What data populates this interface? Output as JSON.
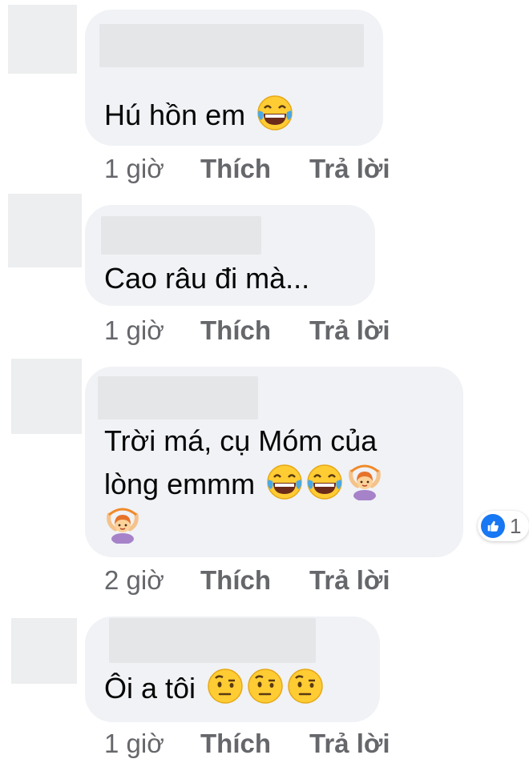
{
  "comments": [
    {
      "text": "Hú hồn em",
      "emojis": [
        "face-with-tears-of-joy-icon"
      ],
      "time": "1 giờ",
      "like_label": "Thích",
      "reply_label": "Trả lời"
    },
    {
      "text": "Cao râu đi mà...",
      "time": "1 giờ",
      "like_label": "Thích",
      "reply_label": "Trả lời"
    },
    {
      "text_line1": "Trời má, cụ Móm của",
      "text_line2": "lòng emmm",
      "emojis": [
        "face-with-tears-of-joy-icon",
        "face-with-tears-of-joy-icon",
        "person-gesturing-ok-icon",
        "person-gesturing-ok-icon"
      ],
      "reaction_count": "1",
      "reaction_icon": "like-icon",
      "time": "2 giờ",
      "like_label": "Thích",
      "reply_label": "Trả lời"
    },
    {
      "text": "Ôi a tôi",
      "emojis": [
        "face-with-raised-eyebrow-icon",
        "face-with-raised-eyebrow-icon",
        "face-with-raised-eyebrow-icon"
      ],
      "time": "1 giờ",
      "like_label": "Thích",
      "reply_label": "Trả lời"
    }
  ],
  "colors": {
    "bubble": "#f0f2f5",
    "text": "#050505",
    "secondary_text": "#65676b",
    "like_blue": "#1877f2"
  }
}
